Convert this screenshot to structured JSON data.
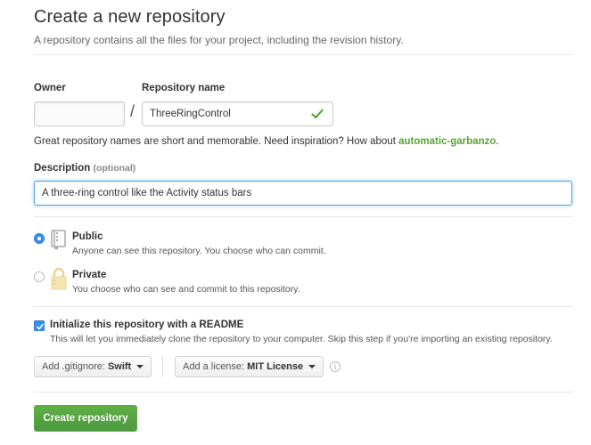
{
  "header": {
    "title": "Create a new repository",
    "subtitle": "A repository contains all the files for your project, including the revision history."
  },
  "owner": {
    "label": "Owner",
    "value": ""
  },
  "repository": {
    "label": "Repository name",
    "value": "ThreeRingControl",
    "valid": true
  },
  "name_hint": {
    "text": "Great repository names are short and memorable. Need inspiration? How about ",
    "suggestion": "automatic-garbanzo",
    "suffix": "."
  },
  "description": {
    "label": "Description",
    "optional": "(optional)",
    "value": "A three-ring control like the Activity status bars"
  },
  "visibility": {
    "options": [
      {
        "title": "Public",
        "desc": "Anyone can see this repository. You choose who can commit.",
        "selected": true,
        "icon": "repo-book-icon"
      },
      {
        "title": "Private",
        "desc": "You choose who can see and commit to this repository.",
        "selected": false,
        "icon": "lock-icon"
      }
    ]
  },
  "readme": {
    "checked": true,
    "label": "Initialize this repository with a README",
    "desc": "This will let you immediately clone the repository to your computer. Skip this step if you're importing an existing repository."
  },
  "gitignore": {
    "prefix": "Add .gitignore:",
    "value": "Swift"
  },
  "license": {
    "prefix": "Add a license:",
    "value": "MIT License"
  },
  "create_button": "Create repository",
  "colors": {
    "primary": "#3b8ff3",
    "success": "#55a532",
    "create_bg": "#55a532"
  }
}
